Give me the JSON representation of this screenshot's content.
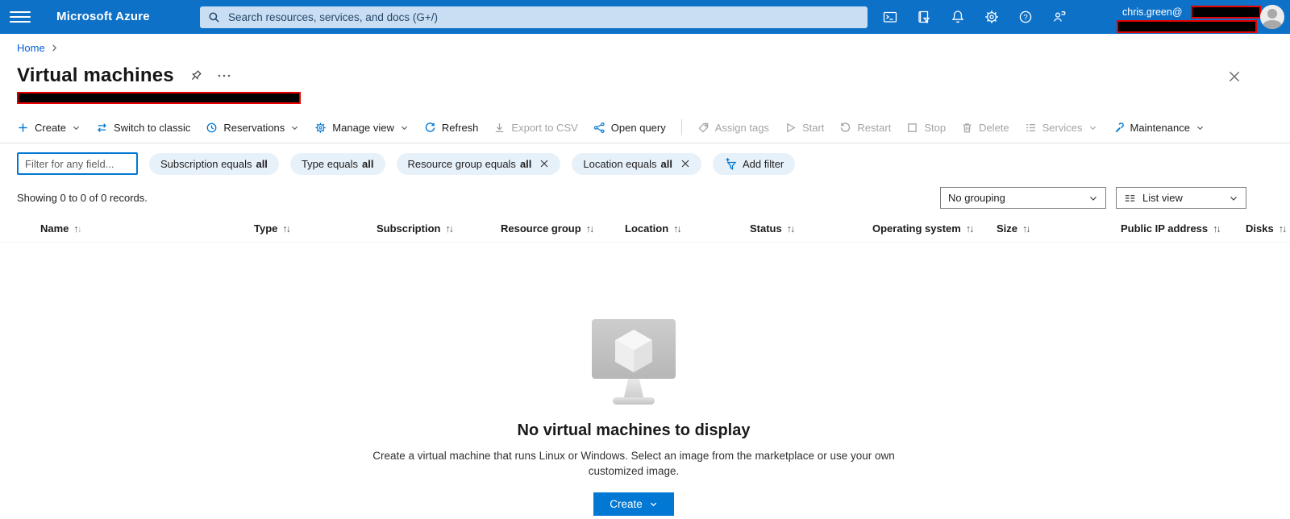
{
  "topbar": {
    "brand": "Microsoft Azure",
    "search_placeholder": "Search resources, services, and docs (G+/)",
    "user_email_prefix": "chris.green@",
    "colors": {
      "bar": "#0e71c8",
      "search_bg": "#c9def2",
      "accent": "#0078d4",
      "redaction_border": "#e80000"
    },
    "icons": [
      "hamburger-icon",
      "search-icon",
      "cloud-shell-icon",
      "directory-filter-icon",
      "notifications-bell-icon",
      "settings-gear-icon",
      "help-icon",
      "feedback-icon",
      "avatar"
    ]
  },
  "breadcrumb": {
    "home": "Home"
  },
  "page": {
    "title": "Virtual machines"
  },
  "toolbar": {
    "items": [
      {
        "label": "Create",
        "enabled": true,
        "chevron": true,
        "icon": "plus-icon"
      },
      {
        "label": "Switch to classic",
        "enabled": true,
        "icon": "swap-arrows-icon"
      },
      {
        "label": "Reservations",
        "enabled": true,
        "chevron": true,
        "icon": "clock-icon"
      },
      {
        "label": "Manage view",
        "enabled": true,
        "chevron": true,
        "icon": "gear-icon"
      },
      {
        "label": "Refresh",
        "enabled": true,
        "icon": "refresh-icon"
      },
      {
        "label": "Export to CSV",
        "enabled": false,
        "icon": "download-icon"
      },
      {
        "label": "Open query",
        "enabled": true,
        "icon": "query-branch-icon"
      },
      {
        "label": "Assign tags",
        "enabled": false,
        "icon": "tag-icon"
      },
      {
        "label": "Start",
        "enabled": false,
        "icon": "play-icon"
      },
      {
        "label": "Restart",
        "enabled": false,
        "icon": "restart-icon"
      },
      {
        "label": "Stop",
        "enabled": false,
        "icon": "stop-square-icon"
      },
      {
        "label": "Delete",
        "enabled": false,
        "icon": "trash-icon"
      },
      {
        "label": "Services",
        "enabled": false,
        "chevron": true,
        "icon": "services-list-icon"
      },
      {
        "label": "Maintenance",
        "enabled": true,
        "chevron": true,
        "icon": "wrench-icon"
      }
    ]
  },
  "filters": {
    "input_placeholder": "Filter for any field...",
    "pills": [
      {
        "text": "Subscription equals",
        "value": "all",
        "closable": false
      },
      {
        "text": "Type equals",
        "value": "all",
        "closable": false
      },
      {
        "text": "Resource group equals",
        "value": "all",
        "closable": true
      },
      {
        "text": "Location equals",
        "value": "all",
        "closable": true
      }
    ],
    "add_filter_label": "Add filter"
  },
  "records": {
    "summary": "Showing 0 to 0 of 0 records.",
    "grouping_value": "No grouping",
    "view_value": "List view"
  },
  "table": {
    "columns": [
      {
        "label": "Name"
      },
      {
        "label": "Type"
      },
      {
        "label": "Subscription"
      },
      {
        "label": "Resource group"
      },
      {
        "label": "Location"
      },
      {
        "label": "Status"
      },
      {
        "label": "Operating system"
      },
      {
        "label": "Size"
      },
      {
        "label": "Public IP address"
      },
      {
        "label": "Disks"
      }
    ]
  },
  "empty_state": {
    "title": "No virtual machines to display",
    "description": "Create a virtual machine that runs Linux or Windows. Select an image from the marketplace or use your own customized image.",
    "create_label": "Create"
  }
}
